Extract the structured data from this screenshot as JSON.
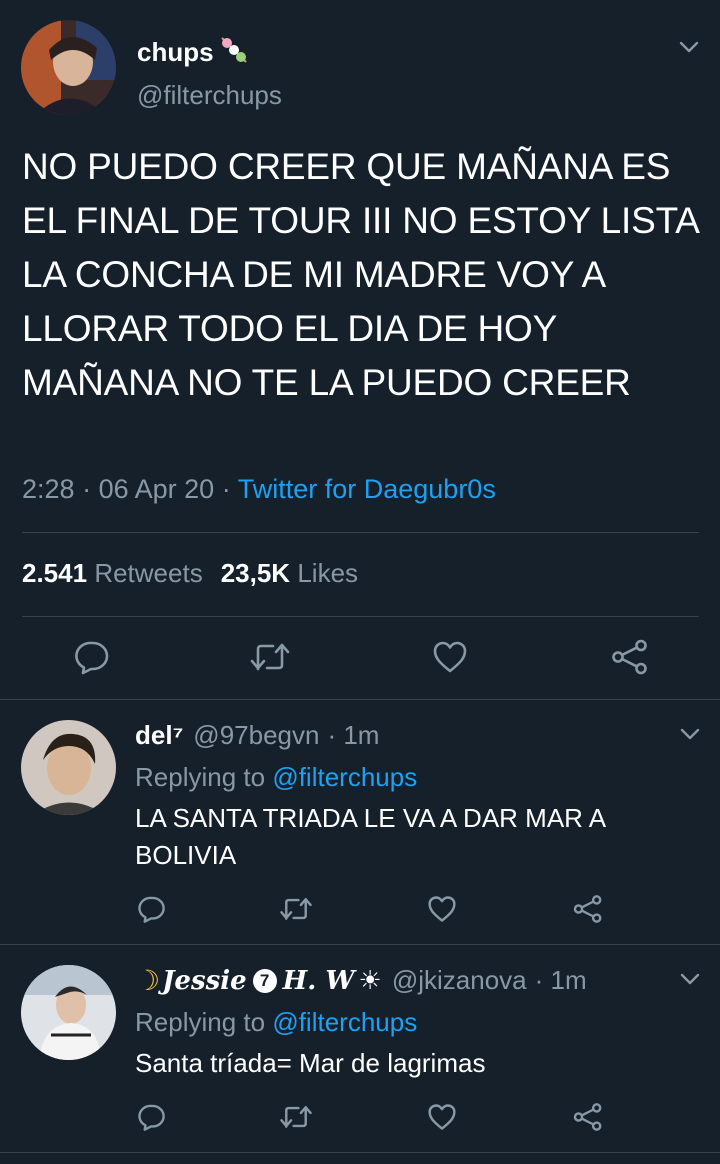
{
  "main_tweet": {
    "name": "chups",
    "name_emoji": "dango-icon",
    "handle": "@filterchups",
    "text": "NO PUEDO CREER QUE MAÑANA ES EL FINAL DE TOUR III NO ESTOY LISTA LA CONCHA DE MI MADRE VOY A LLORAR TODO EL DIA DE HOY MAÑANA NO TE LA PUEDO CREER",
    "time": "2:28",
    "separator": "·",
    "date": "06 Apr 20",
    "source": "Twitter for Daegubr0s",
    "retweets_count": "2.541",
    "retweets_label": "Retweets",
    "likes_count": "23,5K",
    "likes_label": "Likes",
    "icons": [
      "reply-icon",
      "retweet-icon",
      "like-icon",
      "share-icon"
    ]
  },
  "replies": [
    {
      "name": "del⁷",
      "handle": "@97begvn",
      "time": "· 1m",
      "replying_prefix": "Replying to",
      "replying_to": "@filterchups",
      "text": "LA SANTA TRIADA LE VA A DAR MAR A BOLIVIA"
    },
    {
      "name_moon": "☽",
      "name_script": "Jessie",
      "name_badge": "7",
      "name_suffix": "H. W",
      "name_sun": "☀",
      "handle": "@jkizanova",
      "time": "· 1m",
      "replying_prefix": "Replying to",
      "replying_to": "@filterchups",
      "text": "Santa tríada= Mar de lagrimas"
    }
  ],
  "colors": {
    "background": "#15202b",
    "secondary_text": "#8899a6",
    "accent": "#1da1f2",
    "divider": "#38444d"
  }
}
